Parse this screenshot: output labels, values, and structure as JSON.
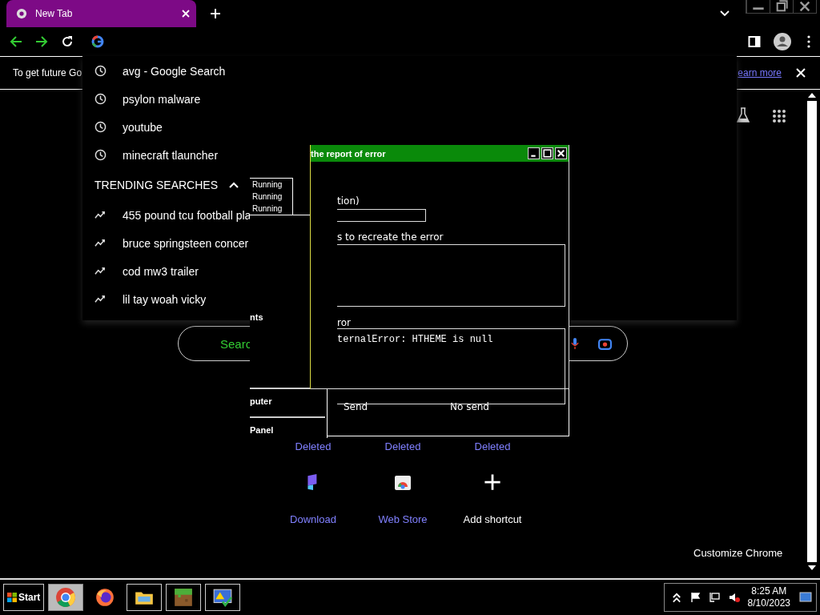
{
  "browser": {
    "tab_title": "New Tab",
    "infobar_text": "To get future Go",
    "infobar_link": "earn more"
  },
  "omnibox_dropdown": {
    "history": [
      "avg - Google Search",
      "psylon malware",
      "youtube",
      "minecraft tlauncher"
    ],
    "trending_heading": "TRENDING SEARCHES",
    "trending": [
      "455 pound tcu football pla",
      "bruce springsteen concer",
      "cod mw3 trailer",
      "lil tay woah vicky"
    ]
  },
  "search_box": {
    "label": "Searc"
  },
  "background_window": {
    "statuses": [
      "Running",
      "Running",
      "Running"
    ],
    "items": [
      "nts",
      "puter",
      "Panel"
    ]
  },
  "error_dialog": {
    "title": "the report of error",
    "label_1": "tion)",
    "label_2": "s to recreate the error",
    "label_3": "ror",
    "error_text": "ternalError: HTHEME is null"
  },
  "send_window": {
    "buttons": [
      "Send",
      "No send"
    ]
  },
  "shortcuts": [
    {
      "label": "Deleted",
      "kind": "deleted"
    },
    {
      "label": "Deleted",
      "kind": "deleted"
    },
    {
      "label": "Deleted",
      "kind": "deleted"
    },
    {
      "label": "Download",
      "kind": "download"
    },
    {
      "label": "Web Store",
      "kind": "store"
    },
    {
      "label": "Add shortcut",
      "kind": "add"
    }
  ],
  "customize": "Customize Chrome",
  "taskbar": {
    "start": "Start",
    "time": "8:25 AM",
    "date": "8/10/2023"
  }
}
